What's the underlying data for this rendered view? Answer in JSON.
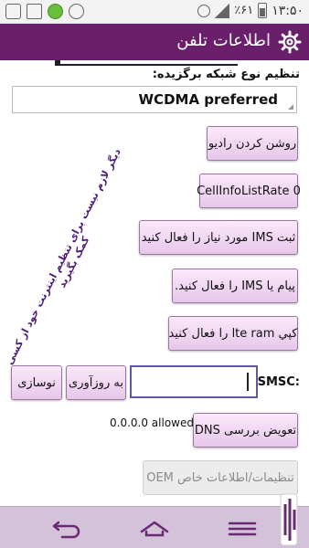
{
  "status_bar": {
    "clock": "۱۳:۵۰",
    "battery": "٪۶۱"
  },
  "app_bar": {
    "title": "اطلاعات تلفن"
  },
  "network": {
    "label": "تنظیم نوع شبکه برگزیده:",
    "selected": "WCDMA preferred"
  },
  "buttons": {
    "radio_on": "روشن کردن رادیو",
    "cellinfo_rate": "CellInfoListRate 0",
    "ims_register": "ثبت IMS مورد نیاز را فعال کنید",
    "sms_over_ims": "پیام یا IMS را فعال کنید.",
    "lte_ram": "کپي lte ram را فعال کنيد",
    "refresh": "نوسازی",
    "update": "به روزآوری",
    "dns_toggle": "تعویض بررسی DNS",
    "oem": "تنظیمات/اطلاعات خاص OEM"
  },
  "diagonal_note": "دیگر لازم نیست برای تنظیم اینترنت خود از کسی کمک بگیرید",
  "smsc": {
    "label": "SMSC:",
    "value": ""
  },
  "dns": {
    "status": "0.0.0.0 allowed"
  },
  "colors": {
    "app_bar": "#6a1f6b",
    "button_fill": "#efd8f0",
    "nav_bar": "#d3c2d9",
    "note_text": "#4d1c7d"
  }
}
